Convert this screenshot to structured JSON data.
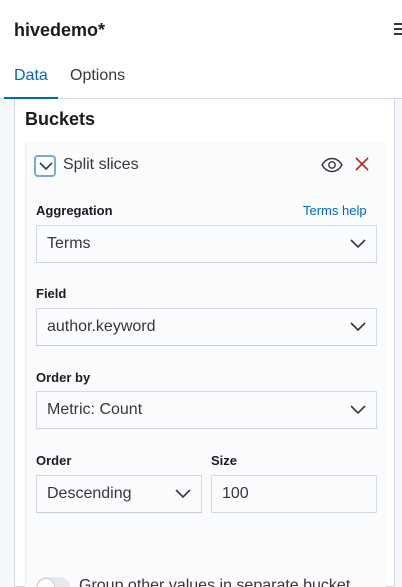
{
  "header": {
    "title": "hivedemo*"
  },
  "tabs": [
    {
      "label": "Data",
      "active": true
    },
    {
      "label": "Options",
      "active": false
    }
  ],
  "buckets": {
    "title": "Buckets",
    "agg": {
      "title": "Split slices",
      "aggregation": {
        "label": "Aggregation",
        "help_link": "Terms help",
        "value": "Terms"
      },
      "field": {
        "label": "Field",
        "value": "author.keyword"
      },
      "order_by": {
        "label": "Order by",
        "value": "Metric: Count"
      },
      "order": {
        "label": "Order",
        "value": "Descending"
      },
      "size": {
        "label": "Size",
        "value": "100"
      },
      "group_other": {
        "label": "Group other values in separate bucket",
        "enabled": false
      }
    }
  },
  "colors": {
    "accent": "#006bb4",
    "danger": "#bd271e"
  }
}
